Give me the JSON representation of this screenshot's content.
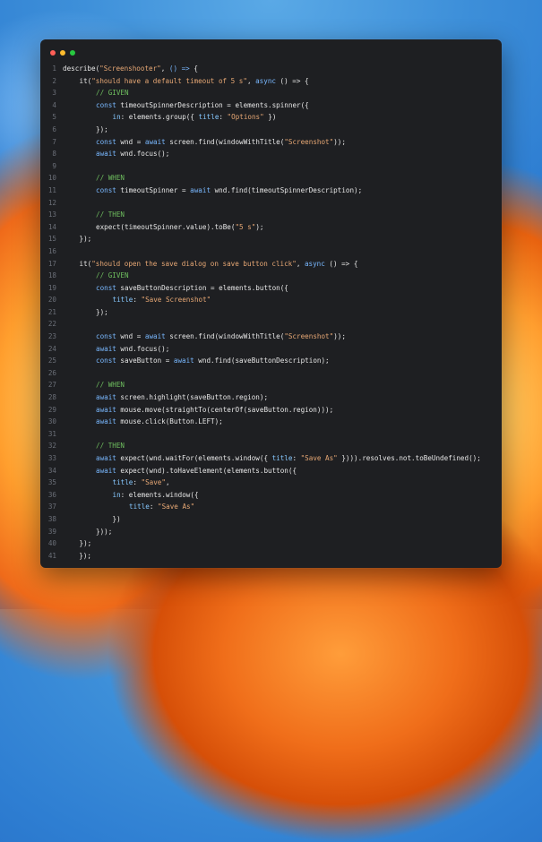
{
  "window": {
    "traffic_lights": [
      {
        "name": "close",
        "color": "#ff5f57"
      },
      {
        "name": "minimize",
        "color": "#febc2e"
      },
      {
        "name": "zoom",
        "color": "#28c840"
      }
    ]
  },
  "code": {
    "lines": [
      {
        "n": "1",
        "indent": 0,
        "t": [
          [
            "p",
            "describe("
          ],
          [
            "s",
            "\"Screenshooter\""
          ],
          [
            "p",
            ", "
          ],
          [
            "k",
            "() =>"
          ],
          [
            "p",
            " {"
          ]
        ]
      },
      {
        "n": "2",
        "indent": 1,
        "t": [
          [
            "p",
            "it("
          ],
          [
            "s",
            "\"should have a default timeout of 5 s\""
          ],
          [
            "p",
            ", "
          ],
          [
            "k",
            "async"
          ],
          [
            "p",
            " () => {"
          ]
        ]
      },
      {
        "n": "3",
        "indent": 2,
        "t": [
          [
            "c",
            "// GIVEN"
          ]
        ]
      },
      {
        "n": "4",
        "indent": 2,
        "t": [
          [
            "k",
            "const"
          ],
          [
            "p",
            " timeoutSpinnerDescription = elements.spinner({"
          ]
        ]
      },
      {
        "n": "5",
        "indent": 3,
        "t": [
          [
            "r",
            "in"
          ],
          [
            "p",
            ": elements.group({ "
          ],
          [
            "r",
            "title"
          ],
          [
            "p",
            ": "
          ],
          [
            "s",
            "\"Options\""
          ],
          [
            "p",
            " })"
          ]
        ]
      },
      {
        "n": "6",
        "indent": 2,
        "t": [
          [
            "p",
            "});"
          ]
        ]
      },
      {
        "n": "7",
        "indent": 2,
        "t": [
          [
            "k",
            "const"
          ],
          [
            "p",
            " wnd = "
          ],
          [
            "k",
            "await"
          ],
          [
            "p",
            " screen.find(windowWithTitle("
          ],
          [
            "s",
            "\"Screenshot\""
          ],
          [
            "p",
            "));"
          ]
        ]
      },
      {
        "n": "8",
        "indent": 2,
        "t": [
          [
            "k",
            "await"
          ],
          [
            "p",
            " wnd.focus();"
          ]
        ]
      },
      {
        "n": "9",
        "indent": 0,
        "t": []
      },
      {
        "n": "10",
        "indent": 2,
        "t": [
          [
            "c",
            "// WHEN"
          ]
        ]
      },
      {
        "n": "11",
        "indent": 2,
        "t": [
          [
            "k",
            "const"
          ],
          [
            "p",
            " timeoutSpinner = "
          ],
          [
            "k",
            "await"
          ],
          [
            "p",
            " wnd.find(timeoutSpinnerDescription);"
          ]
        ]
      },
      {
        "n": "12",
        "indent": 0,
        "t": []
      },
      {
        "n": "13",
        "indent": 2,
        "t": [
          [
            "c",
            "// THEN"
          ]
        ]
      },
      {
        "n": "14",
        "indent": 2,
        "t": [
          [
            "p",
            "expect(timeoutSpinner.value).toBe("
          ],
          [
            "s",
            "\"5 s\""
          ],
          [
            "p",
            ");"
          ]
        ]
      },
      {
        "n": "15",
        "indent": 1,
        "t": [
          [
            "p",
            "});"
          ]
        ]
      },
      {
        "n": "16",
        "indent": 0,
        "t": []
      },
      {
        "n": "17",
        "indent": 1,
        "t": [
          [
            "p",
            "it("
          ],
          [
            "s",
            "\"should open the save dialog on save button click\""
          ],
          [
            "p",
            ", "
          ],
          [
            "k",
            "async"
          ],
          [
            "p",
            " () => {"
          ]
        ]
      },
      {
        "n": "18",
        "indent": 2,
        "t": [
          [
            "c",
            "// GIVEN"
          ]
        ]
      },
      {
        "n": "19",
        "indent": 2,
        "t": [
          [
            "k",
            "const"
          ],
          [
            "p",
            " saveButtonDescription = elements.button({"
          ]
        ]
      },
      {
        "n": "20",
        "indent": 3,
        "t": [
          [
            "r",
            "title"
          ],
          [
            "p",
            ": "
          ],
          [
            "s",
            "\"Save Screenshot\""
          ]
        ]
      },
      {
        "n": "21",
        "indent": 2,
        "t": [
          [
            "p",
            "});"
          ]
        ]
      },
      {
        "n": "22",
        "indent": 0,
        "t": []
      },
      {
        "n": "23",
        "indent": 2,
        "t": [
          [
            "k",
            "const"
          ],
          [
            "p",
            " wnd = "
          ],
          [
            "k",
            "await"
          ],
          [
            "p",
            " screen.find(windowWithTitle("
          ],
          [
            "s",
            "\"Screenshot\""
          ],
          [
            "p",
            "));"
          ]
        ]
      },
      {
        "n": "24",
        "indent": 2,
        "t": [
          [
            "k",
            "await"
          ],
          [
            "p",
            " wnd.focus();"
          ]
        ]
      },
      {
        "n": "25",
        "indent": 2,
        "t": [
          [
            "k",
            "const"
          ],
          [
            "p",
            " saveButton = "
          ],
          [
            "k",
            "await"
          ],
          [
            "p",
            " wnd.find(saveButtonDescription);"
          ]
        ]
      },
      {
        "n": "26",
        "indent": 0,
        "t": []
      },
      {
        "n": "27",
        "indent": 2,
        "t": [
          [
            "c",
            "// WHEN"
          ]
        ]
      },
      {
        "n": "28",
        "indent": 2,
        "t": [
          [
            "k",
            "await"
          ],
          [
            "p",
            " screen.highlight(saveButton.region);"
          ]
        ]
      },
      {
        "n": "29",
        "indent": 2,
        "t": [
          [
            "k",
            "await"
          ],
          [
            "p",
            " mouse.move(straightTo(centerOf(saveButton.region)));"
          ]
        ]
      },
      {
        "n": "30",
        "indent": 2,
        "t": [
          [
            "k",
            "await"
          ],
          [
            "p",
            " mouse.click(Button.LEFT);"
          ]
        ]
      },
      {
        "n": "31",
        "indent": 0,
        "t": []
      },
      {
        "n": "32",
        "indent": 2,
        "t": [
          [
            "c",
            "// THEN"
          ]
        ]
      },
      {
        "n": "33",
        "indent": 2,
        "t": [
          [
            "k",
            "await"
          ],
          [
            "p",
            " expect(wnd.waitFor(elements.window({ "
          ],
          [
            "r",
            "title"
          ],
          [
            "p",
            ": "
          ],
          [
            "s",
            "\"Save As\""
          ],
          [
            "p",
            " }))).resolves.not.toBeUndefined();"
          ]
        ]
      },
      {
        "n": "34",
        "indent": 2,
        "t": [
          [
            "k",
            "await"
          ],
          [
            "p",
            " expect(wnd).toHaveElement(elements.button({"
          ]
        ]
      },
      {
        "n": "35",
        "indent": 3,
        "t": [
          [
            "r",
            "title"
          ],
          [
            "p",
            ": "
          ],
          [
            "s",
            "\"Save\""
          ],
          [
            "p",
            ","
          ]
        ]
      },
      {
        "n": "36",
        "indent": 3,
        "t": [
          [
            "r",
            "in"
          ],
          [
            "p",
            ": elements.window({"
          ]
        ]
      },
      {
        "n": "37",
        "indent": 4,
        "t": [
          [
            "r",
            "title"
          ],
          [
            "p",
            ": "
          ],
          [
            "s",
            "\"Save As\""
          ]
        ]
      },
      {
        "n": "38",
        "indent": 3,
        "t": [
          [
            "p",
            "})"
          ]
        ]
      },
      {
        "n": "39",
        "indent": 2,
        "t": [
          [
            "p",
            "}));"
          ]
        ]
      },
      {
        "n": "40",
        "indent": 1,
        "t": [
          [
            "p",
            "});"
          ]
        ]
      },
      {
        "n": "41",
        "indent": 0,
        "t": [
          [
            "p",
            "    });"
          ]
        ]
      }
    ]
  }
}
